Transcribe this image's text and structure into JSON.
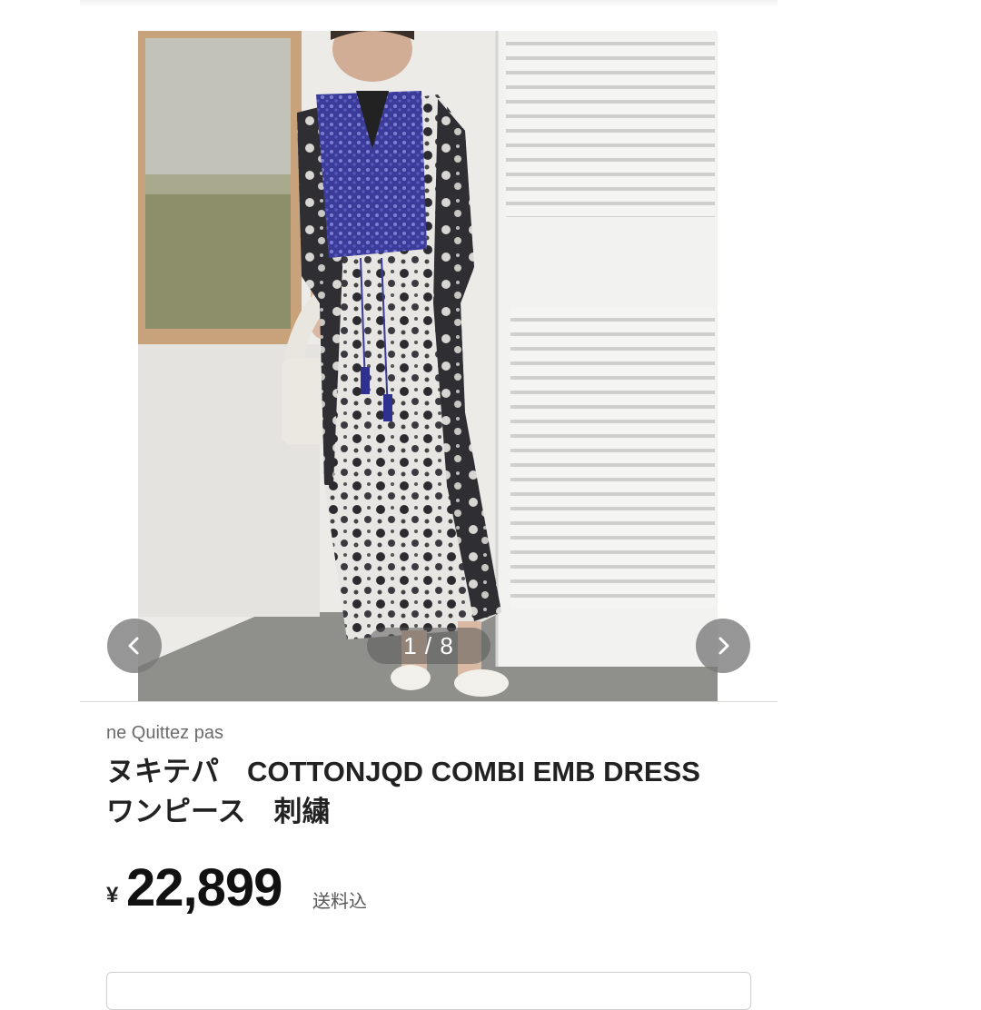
{
  "product": {
    "brand": "ne Quittez pas",
    "title": "ヌキテパ　COTTONJQD COMBI EMB DRESS\nワンピース　刺繍",
    "currency_symbol": "¥",
    "price": "22,899",
    "shipping_note": "送料込"
  },
  "gallery": {
    "counter": "1 / 8",
    "prev_icon": "chevron-left-icon",
    "next_icon": "chevron-right-icon",
    "photo_subject": "model wearing sleeveless patterned dress with blue embroidered bib"
  },
  "colors": {
    "nav_button": "#787878",
    "text_primary": "#222222",
    "text_secondary": "#6b6b6b"
  }
}
